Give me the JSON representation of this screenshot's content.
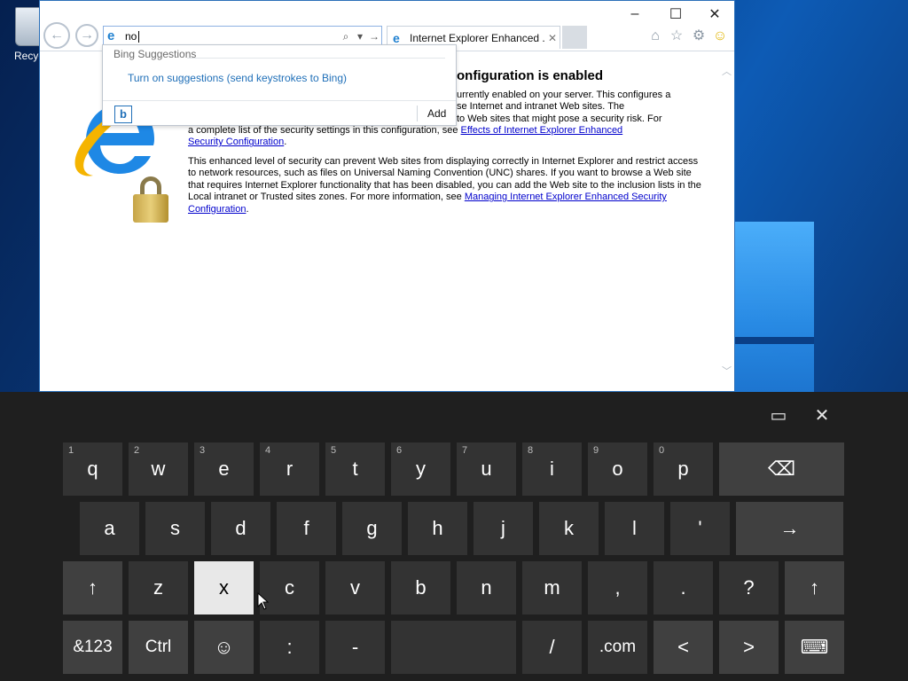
{
  "desktop": {
    "recycle_bin_label": "Recycl"
  },
  "window": {
    "caption": {
      "minimize": "–",
      "maximize": "☐",
      "close": "✕"
    },
    "address_bar": {
      "value": "no",
      "search_glyph": "⌕",
      "dropdown_glyph": "▾",
      "go_glyph": "→"
    },
    "tab": {
      "label": "Internet Explorer Enhanced ...",
      "close": "✕"
    },
    "toolbar_icons": [
      "home-icon",
      "favorites-star-icon",
      "gear-icon",
      "smiley-feedback-icon"
    ]
  },
  "page": {
    "heading": "onfiguration is enabled",
    "para1_line1": "urrently enabled on your server. This configures a",
    "para1_line2": "se Internet and intranet Web sites. The",
    "para1_line3": "to Web sites that might pose a security risk. For",
    "para1_line4a": "a complete list of the security settings in this configuration, see ",
    "link1_a": "Effects of Internet Explorer Enhanced",
    "link1_b": "Security Configuration",
    "para2_a": "This enhanced level of security can prevent Web sites from displaying correctly in Internet Explorer and restrict access to network resources, such as files on Universal Naming Convention (UNC) shares. If you want to browse a Web site that requires Internet Explorer functionality that has been disabled, you can add the Web site to the inclusion lists in the Local intranet or Trusted sites zones. For more information, see ",
    "link2": "Managing Internet Explorer Enhanced Security Configuration",
    "period": "."
  },
  "suggestions": {
    "header": "Bing Suggestions",
    "turn_on": "Turn on suggestions (send keystrokes to Bing)",
    "bing_glyph": "b",
    "add_label": "Add"
  },
  "keyboard": {
    "row1": [
      {
        "label": "q",
        "num": "1"
      },
      {
        "label": "w",
        "num": "2"
      },
      {
        "label": "e",
        "num": "3"
      },
      {
        "label": "r",
        "num": "4"
      },
      {
        "label": "t",
        "num": "5"
      },
      {
        "label": "y",
        "num": "6"
      },
      {
        "label": "u",
        "num": "7"
      },
      {
        "label": "i",
        "num": "8"
      },
      {
        "label": "o",
        "num": "9"
      },
      {
        "label": "p",
        "num": "0"
      }
    ],
    "row2": [
      "a",
      "s",
      "d",
      "f",
      "g",
      "h",
      "j",
      "k",
      "l",
      "'"
    ],
    "row3": [
      "z",
      "x",
      "c",
      "v",
      "b",
      "n",
      "m",
      ",",
      ".",
      "?"
    ],
    "backspace": "⌫",
    "enter": "→",
    "shift": "↑",
    "symbols": "&123",
    "ctrl": "Ctrl",
    "emoji": "☺",
    "colon": ":",
    "dash": "-",
    "slash": "/",
    "dotcom": ".com",
    "left": "<",
    "right": ">",
    "keyboard_toggle": "⌨",
    "dock_icon": "▭",
    "close_icon": "✕"
  }
}
